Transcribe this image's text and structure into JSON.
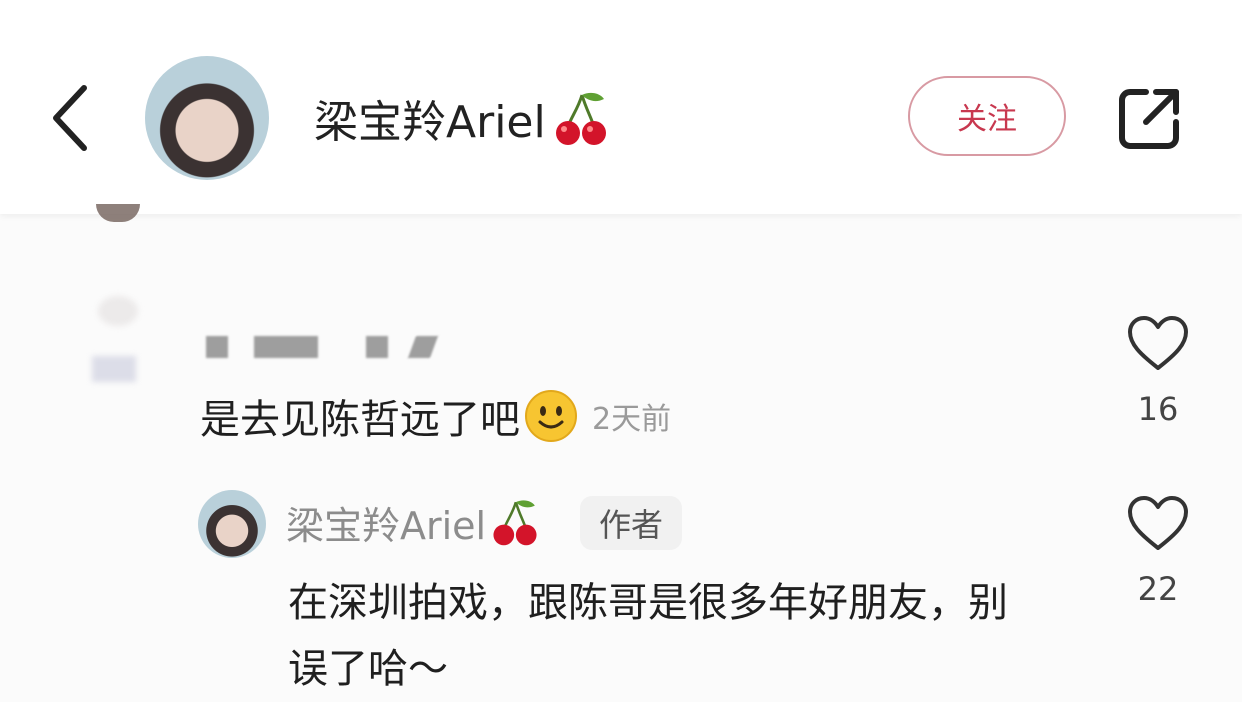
{
  "header": {
    "username": "梁宝羚Ariel",
    "follow_label": "关注",
    "emoji_icon": "cherry-icon"
  },
  "comment": {
    "text": "是去见陈哲远了吧",
    "emoji_icon": "smiley-icon",
    "time": "2天前",
    "likes": "16"
  },
  "reply": {
    "username": "梁宝羚Ariel",
    "author_tag": "作者",
    "text": "在深圳拍戏，跟陈哥是很多年好朋友，别误了哈～",
    "likes": "22"
  },
  "colors": {
    "accent": "#c8384f",
    "follow_border": "#d89aa3",
    "muted_text": "#9a9a9a"
  }
}
